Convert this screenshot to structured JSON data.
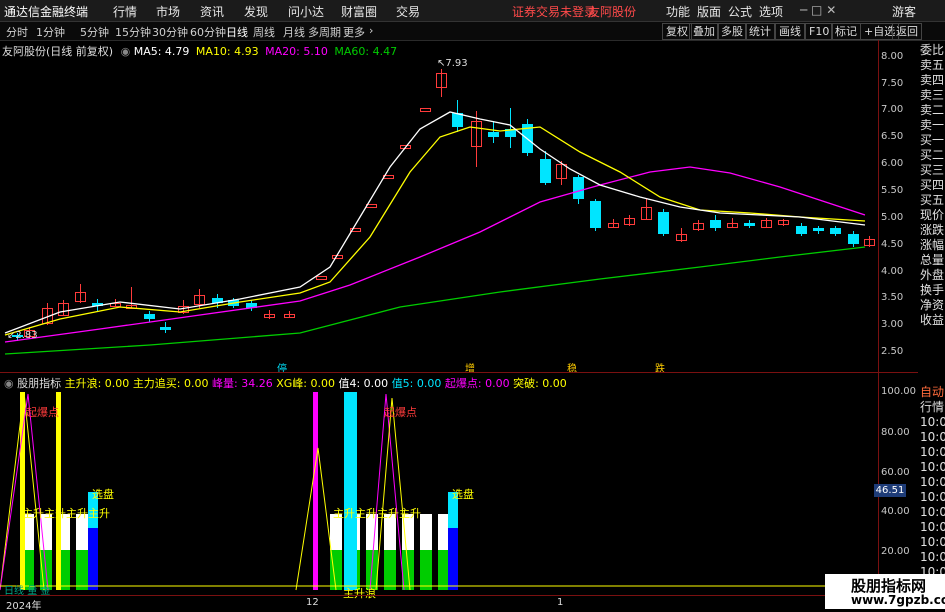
{
  "menubar": {
    "logo": "通达信金融终端",
    "items": [
      "行情",
      "市场",
      "资讯",
      "发现",
      "问小达",
      "财富圈",
      "交易"
    ],
    "login_warning": "证券交易未登录",
    "stock_name": "友阿股份",
    "right_items": [
      "功能",
      "版面",
      "公式",
      "选项",
      "游客"
    ]
  },
  "periods": [
    "分时",
    "1分钟",
    "5分钟",
    "15分钟",
    "30分钟",
    "60分钟",
    "日线",
    "周线",
    "月线",
    "多周期",
    "更多"
  ],
  "selected_period": "日线",
  "toolbar_right": [
    "复权",
    "叠加",
    "多股",
    "统计",
    "画线",
    "F10",
    "标记",
    "+自选",
    "返回"
  ],
  "chart_header": {
    "title": "友阿股份(日线 前复权)",
    "ma5": "MA5: 4.79",
    "ma10": "MA10: 4.93",
    "ma20": "MA20: 5.10",
    "ma60": "MA60: 4.47"
  },
  "side_quote": [
    "委比",
    "卖五",
    "卖四",
    "卖三",
    "卖二",
    "卖一",
    "买一",
    "买二",
    "买三",
    "买四",
    "买五",
    "现价",
    "涨跌",
    "涨幅",
    "总量",
    "外盘",
    "换手",
    "净资",
    "收益"
  ],
  "side_lower": [
    "自动",
    "行情",
    "10:03",
    "10:03",
    "10:03",
    "10:03",
    "10:03",
    "10:03",
    "10:03",
    "10:03",
    "10:03",
    "10:03",
    "10:03"
  ],
  "price_axis": [
    "8.00",
    "7.50",
    "7.00",
    "6.50",
    "6.00",
    "5.50",
    "5.00",
    "4.50",
    "4.00",
    "3.50",
    "3.00",
    "2.50"
  ],
  "high_label": "7.93",
  "low_label": "2.83",
  "event_markers": [
    "停",
    "增",
    "稳",
    "跌"
  ],
  "indicator_header": {
    "name": "股朋指标",
    "fields": [
      "主升浪: 0.00",
      "主力追买: 0.00",
      "峰量: 34.26",
      "XG峰: 0.00",
      "值4: 0.00",
      "值5: 0.00",
      "起爆点: 0.00",
      "突破: 0.00"
    ]
  },
  "indicator_axis": [
    "100.00",
    "80.00",
    "60.00",
    "40.00",
    "20.00"
  ],
  "indicator_value_tag": "46.51",
  "indicator_labels": {
    "ignition": "起爆点",
    "pick": "选盘",
    "surge": "主升浪",
    "ignition2": "起爆点",
    "pick2": "选盘",
    "rise_text": "主升主升主升主升"
  },
  "date_axis": [
    "2024年",
    "12",
    "1"
  ],
  "bottom_tabs": [
    "日线",
    "量",
    "金"
  ],
  "watermark": {
    "name": "股朋指标网",
    "url": "www.7gpzb.com"
  },
  "colors": {
    "up": "#ff3b3b",
    "down": "#00e5ff",
    "ma5": "#ffffff",
    "ma10": "#ffff00",
    "ma20": "#ff00ff",
    "ma60": "#00cc00",
    "accent": "#ffcc00"
  }
}
